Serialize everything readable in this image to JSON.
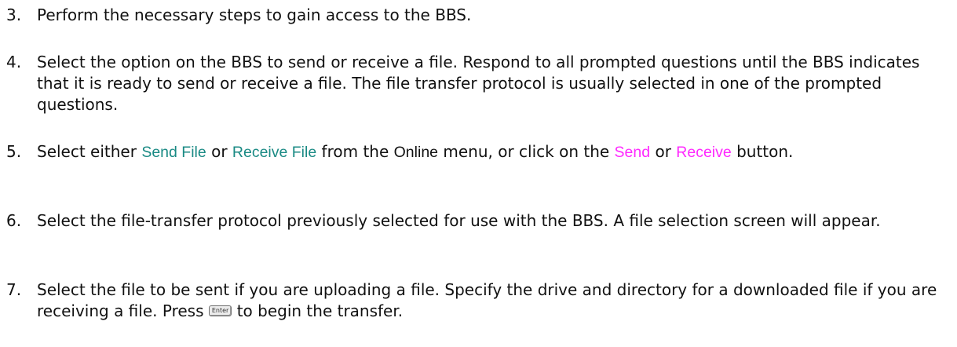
{
  "steps": [
    {
      "number": "3.",
      "text": "Perform the necessary steps to gain access to the BBS."
    },
    {
      "number": "4.",
      "text": "Select the option on the BBS to send or receive a file. Respond to all prompted questions until the BBS indicates that it is ready to send or receive a file. The file transfer protocol is usually selected in one of the prompted questions."
    },
    {
      "number": "5.",
      "pre": "Select either ",
      "send_file": "Send File",
      "or1": " or ",
      "receive_file": "Receive File",
      "from": " from the ",
      "online_menu": "Online",
      "menu_click": " menu, or click on the ",
      "send": "Send",
      "or2": " or ",
      "receive": "Receive",
      "post": " button."
    },
    {
      "number": "6.",
      "text": "Select the file-transfer protocol previously selected for use with the BBS. A file selection screen will appear."
    },
    {
      "number": "7.",
      "pre": "Select the file to be sent if you are uploading a file. Specify the drive and directory for a downloaded file if you are receiving a file. Press ",
      "key_label": "Enter",
      "post": " to begin the transfer."
    }
  ],
  "colors": {
    "link_teal": "#1a8a84",
    "link_pink": "#ff29ff"
  }
}
